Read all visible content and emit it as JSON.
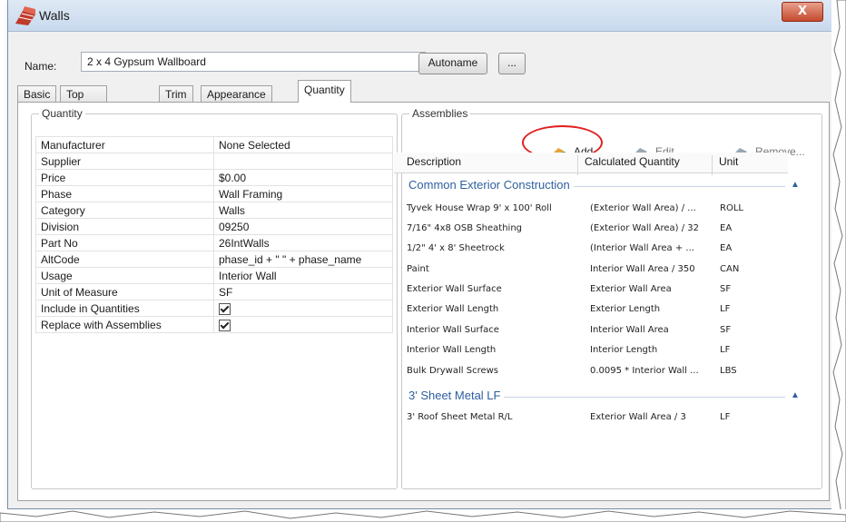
{
  "window": {
    "title": "Walls",
    "close_label": "X"
  },
  "name_row": {
    "label": "Name:",
    "value": "2 x 4 Gypsum Wallboard",
    "autoname_label": "Autoname",
    "ellipsis_label": "..."
  },
  "tabs": [
    {
      "label": "Basic"
    },
    {
      "label": "Top and Bottom"
    },
    {
      "label": "Trim"
    },
    {
      "label": "Appearance"
    },
    {
      "label": "Quantity"
    }
  ],
  "quantity_group": {
    "label": "Quantity",
    "rows": [
      {
        "key": "Manufacturer",
        "value": "None Selected"
      },
      {
        "key": "Supplier",
        "value": ""
      },
      {
        "key": "Price",
        "value": "$0.00"
      },
      {
        "key": "Phase",
        "value": "Wall Framing"
      },
      {
        "key": "Category",
        "value": "Walls"
      },
      {
        "key": "Division",
        "value": "09250"
      },
      {
        "key": "Part No",
        "value": "26IntWalls"
      },
      {
        "key": "AltCode",
        "value": "phase_id + \" \" + phase_name"
      },
      {
        "key": "Usage",
        "value": "Interior Wall"
      },
      {
        "key": "Unit of Measure",
        "value": "SF"
      },
      {
        "key": "Include in Quantities",
        "value": "",
        "checked": true
      },
      {
        "key": "Replace with Assemblies",
        "value": "",
        "checked": true
      }
    ]
  },
  "assemblies": {
    "label": "Assemblies",
    "toolbar": {
      "add_label": "Add...",
      "edit_label": "Edit...",
      "remove_label": "Remove..."
    },
    "columns": [
      "Description",
      "Calculated Quantity",
      "Unit"
    ],
    "groups": [
      {
        "name": "Common Exterior Construction",
        "rows": [
          {
            "description": "Tyvek House Wrap 9' x 100' Roll",
            "quantity": "(Exterior Wall Area) / ...",
            "unit": "ROLL"
          },
          {
            "description": "7/16\" 4x8 OSB Sheathing",
            "quantity": "(Exterior Wall Area) / 32",
            "unit": "EA"
          },
          {
            "description": "1/2\" 4' x 8' Sheetrock",
            "quantity": "(Interior Wall Area + ...",
            "unit": "EA"
          },
          {
            "description": "Paint",
            "quantity": "Interior Wall Area / 350",
            "unit": "CAN"
          },
          {
            "description": "Exterior Wall Surface",
            "quantity": "Exterior Wall Area",
            "unit": "SF"
          },
          {
            "description": "Exterior Wall Length",
            "quantity": "Exterior Length",
            "unit": "LF"
          },
          {
            "description": "Interior Wall Surface",
            "quantity": "Interior Wall Area",
            "unit": "SF"
          },
          {
            "description": "Interior Wall Length",
            "quantity": "Interior Length",
            "unit": "LF"
          },
          {
            "description": "Bulk Drywall Screws",
            "quantity": "0.0095 * Interior Wall ...",
            "unit": "LBS"
          }
        ]
      },
      {
        "name": "3' Sheet Metal LF",
        "rows": [
          {
            "description": "3' Roof Sheet Metal R/L",
            "quantity": "Exterior Wall Area / 3",
            "unit": "LF"
          }
        ]
      }
    ]
  },
  "icons": {
    "title": "walls-icon",
    "add": "add-assembly-icon",
    "edit": "edit-assembly-icon",
    "remove": "remove-assembly-icon",
    "collapse": "collapse-chevron-icon"
  },
  "colors": {
    "group_header": "#2e5f9e",
    "highlight_circle": "#e02020",
    "close_button": "#c44a2e"
  }
}
